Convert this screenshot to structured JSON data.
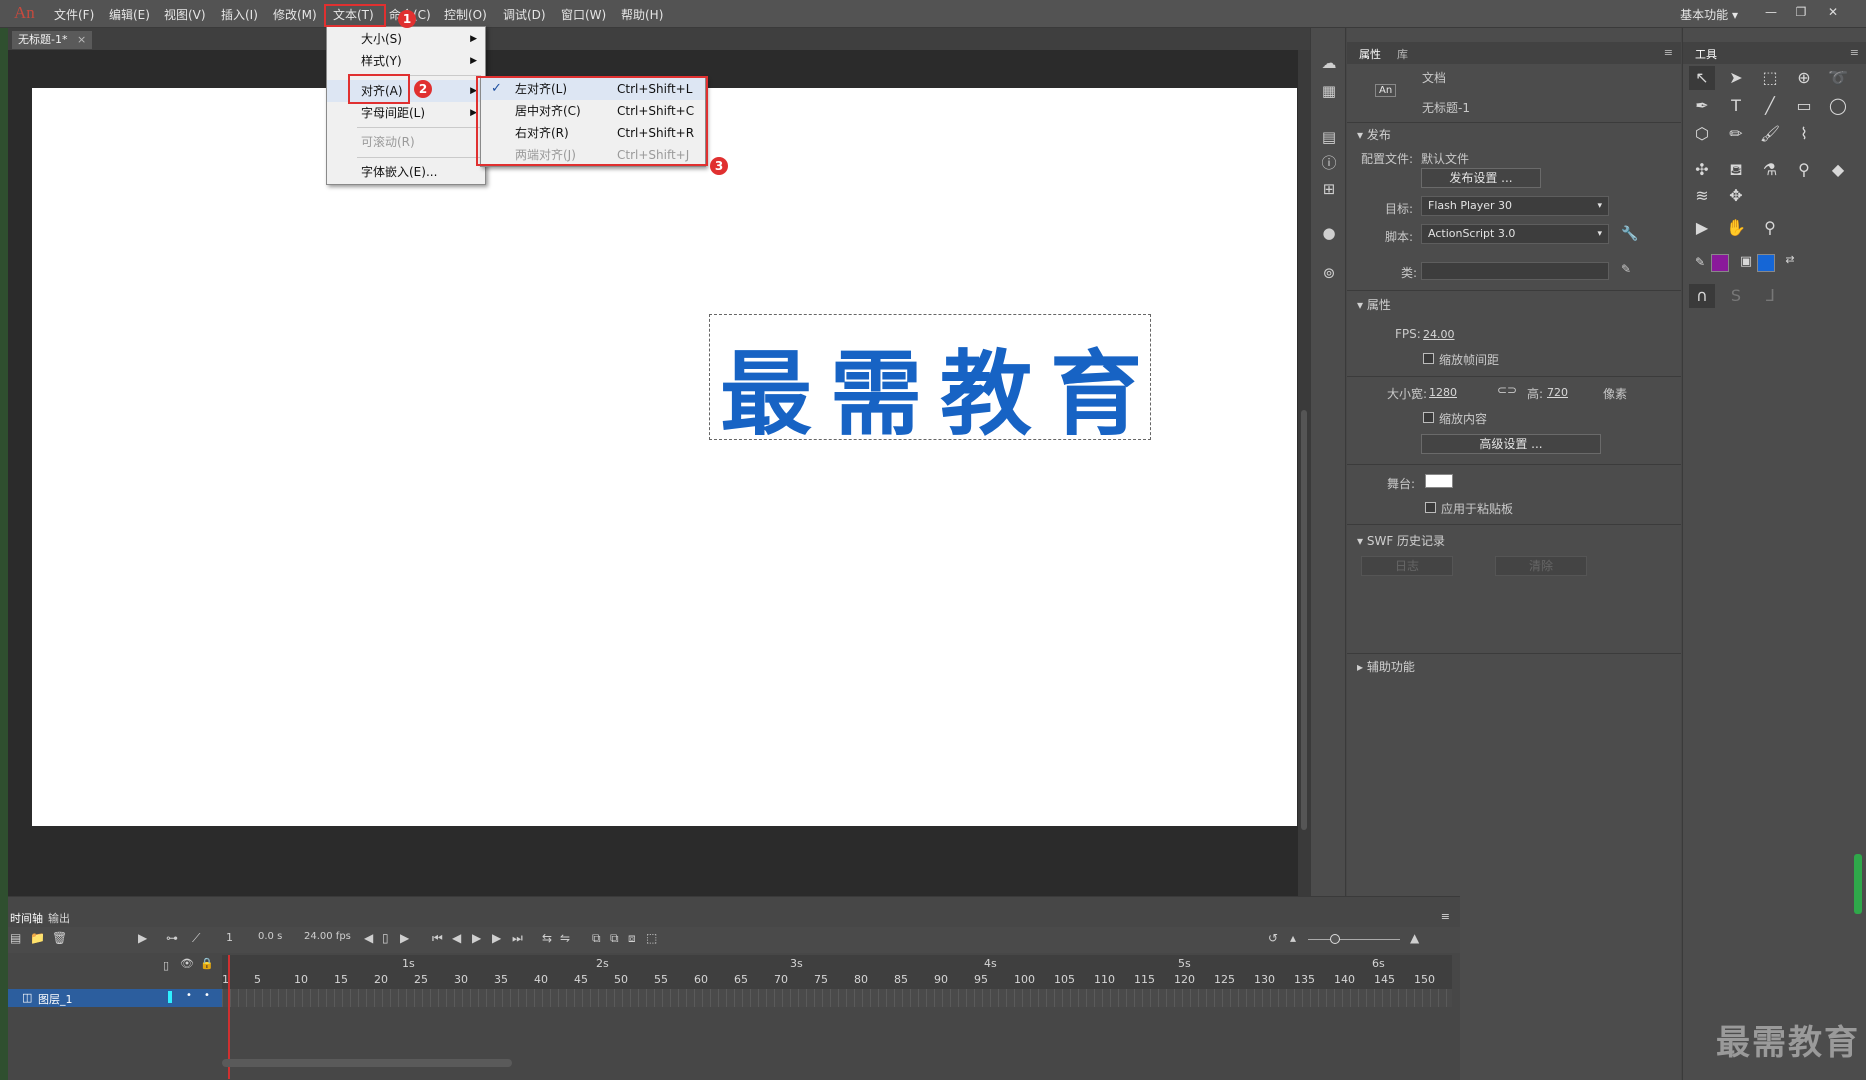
{
  "app": {
    "logo": "An",
    "workspace": "基本功能"
  },
  "menubar": {
    "items": [
      "文件(F)",
      "编辑(E)",
      "视图(V)",
      "插入(I)",
      "修改(M)",
      "文本(T)",
      "命令(C)",
      "控制(O)",
      "调试(D)",
      "窗口(W)",
      "帮助(H)"
    ]
  },
  "document": {
    "tab": "无标题-1*",
    "close": "×"
  },
  "stage": {
    "text": "最需教育",
    "text_color": "#1763c4"
  },
  "text_menu": {
    "items": [
      {
        "label": "大小(S)",
        "submenu": true,
        "disabled": false
      },
      {
        "label": "样式(Y)",
        "submenu": true,
        "disabled": false
      },
      {
        "label": "对齐(A)",
        "submenu": true,
        "disabled": false
      },
      {
        "label": "字母间距(L)",
        "submenu": true,
        "disabled": false
      },
      {
        "label": "可滚动(R)",
        "submenu": false,
        "disabled": true
      },
      {
        "label": "字体嵌入(E)...",
        "submenu": false,
        "disabled": false
      }
    ]
  },
  "align_submenu": {
    "items": [
      {
        "label": "左对齐(L)",
        "shortcut": "Ctrl+Shift+L",
        "checked": true,
        "disabled": false
      },
      {
        "label": "居中对齐(C)",
        "shortcut": "Ctrl+Shift+C",
        "checked": false,
        "disabled": false
      },
      {
        "label": "右对齐(R)",
        "shortcut": "Ctrl+Shift+R",
        "checked": false,
        "disabled": false
      },
      {
        "label": "两端对齐(J)",
        "shortcut": "Ctrl+Shift+J",
        "checked": false,
        "disabled": true
      }
    ]
  },
  "annotations": {
    "badge1": "1",
    "badge2": "2",
    "badge3": "3",
    "color": "#e03030"
  },
  "properties": {
    "tabs": [
      "属性",
      "库"
    ],
    "doc_type": "文档",
    "doc_name": "无标题-1",
    "doc_icon": "An",
    "publish": {
      "section": "发布",
      "profile_label": "配置文件:",
      "profile_value": "默认文件",
      "settings_button": "发布设置 ...",
      "target_label": "目标:",
      "target_value": "Flash Player 30",
      "script_label": "脚本:",
      "script_value": "ActionScript 3.0",
      "class_label": "类:"
    },
    "attributes": {
      "section": "属性",
      "fps_label": "FPS:",
      "fps_value": "24.00",
      "scale_frames": "缩放帧间距",
      "size_label": "大小:",
      "width_label": "宽:",
      "width_value": "1280",
      "height_label": "高:",
      "height_value": "720",
      "unit": "像素",
      "scale_content": "缩放内容",
      "advanced_button": "高级设置 ...",
      "stage_label": "舞台:",
      "stage_color": "#ffffff",
      "apply_pasteboard": "应用于粘贴板"
    },
    "swf_history": {
      "section": "SWF 历史记录",
      "log_button": "日志",
      "clear_button": "清除"
    },
    "accessibility": {
      "section": "辅助功能"
    }
  },
  "tools": {
    "title": "工具",
    "stroke_color": "#8a1a9a",
    "fill_color": "#1566d6"
  },
  "timeline": {
    "tabs": [
      "时间轴",
      "输出"
    ],
    "current_frame": "1",
    "time": "0.0 s",
    "fps": "24.00 fps",
    "layer_name": "图层_1",
    "seconds": [
      "1s",
      "2s",
      "3s",
      "4s",
      "5s",
      "6s"
    ],
    "ticks": [
      "1",
      "5",
      "10",
      "15",
      "20",
      "25",
      "30",
      "35",
      "40",
      "45",
      "50",
      "55",
      "60",
      "65",
      "70",
      "75",
      "80",
      "85",
      "90",
      "95",
      "100",
      "105",
      "110",
      "115",
      "120",
      "125",
      "130",
      "135",
      "140",
      "145",
      "150"
    ]
  },
  "watermark": "最需教育"
}
